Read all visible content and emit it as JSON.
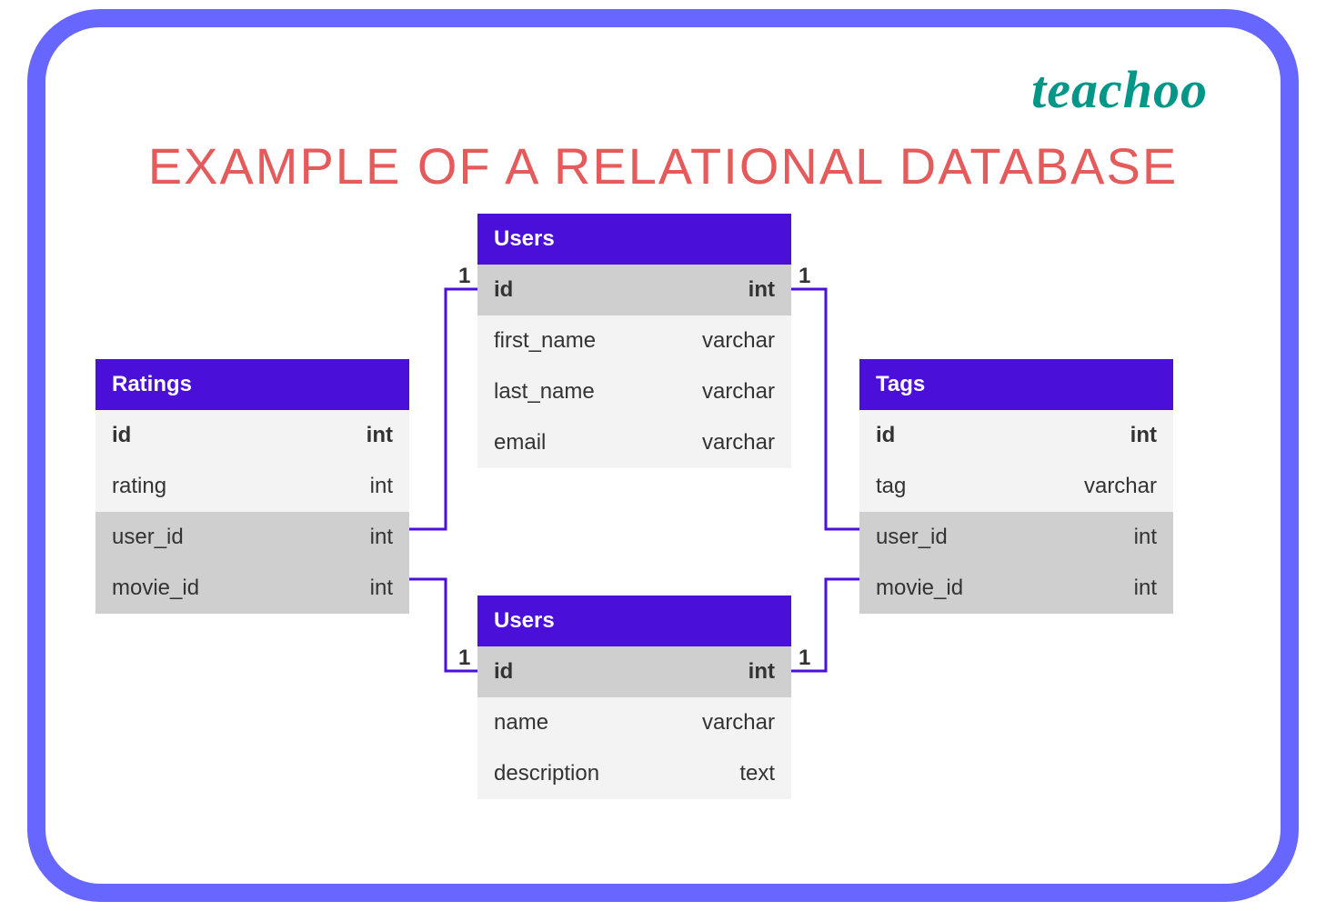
{
  "brand": "teachoo",
  "title": "EXAMPLE OF A RELATIONAL DATABASE",
  "tables": {
    "ratings": {
      "name": "Ratings",
      "rows": [
        {
          "field": "id",
          "type": "int",
          "shade": "light",
          "bold": true
        },
        {
          "field": "rating",
          "type": "int",
          "shade": "light",
          "bold": false
        },
        {
          "field": "user_id",
          "type": "int",
          "shade": "dark",
          "bold": false
        },
        {
          "field": "movie_id",
          "type": "int",
          "shade": "dark",
          "bold": false
        }
      ]
    },
    "users_top": {
      "name": "Users",
      "rows": [
        {
          "field": "id",
          "type": "int",
          "shade": "dark",
          "bold": true
        },
        {
          "field": "first_name",
          "type": "varchar",
          "shade": "light",
          "bold": false
        },
        {
          "field": "last_name",
          "type": "varchar",
          "shade": "light",
          "bold": false
        },
        {
          "field": "email",
          "type": "varchar",
          "shade": "light",
          "bold": false
        }
      ]
    },
    "users_bottom": {
      "name": "Users",
      "rows": [
        {
          "field": "id",
          "type": "int",
          "shade": "dark",
          "bold": true
        },
        {
          "field": "name",
          "type": "varchar",
          "shade": "light",
          "bold": false
        },
        {
          "field": "description",
          "type": "text",
          "shade": "light",
          "bold": false
        }
      ]
    },
    "tags": {
      "name": "Tags",
      "rows": [
        {
          "field": "id",
          "type": "int",
          "shade": "light",
          "bold": true
        },
        {
          "field": "tag",
          "type": "varchar",
          "shade": "light",
          "bold": false
        },
        {
          "field": "user_id",
          "type": "int",
          "shade": "dark",
          "bold": false
        },
        {
          "field": "movie_id",
          "type": "int",
          "shade": "dark",
          "bold": false
        }
      ]
    }
  },
  "cardinalities": {
    "c1": "1",
    "c2": "1",
    "c3": "1",
    "c4": "1"
  }
}
